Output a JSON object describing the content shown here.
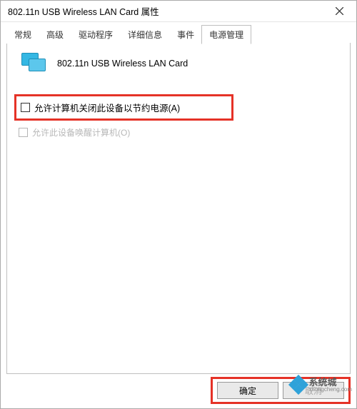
{
  "window": {
    "title": "802.11n USB Wireless LAN Card 属性"
  },
  "tabs": {
    "t0": "常规",
    "t1": "高级",
    "t2": "驱动程序",
    "t3": "详细信息",
    "t4": "事件",
    "t5": "电源管理"
  },
  "device": {
    "name": "802.11n USB Wireless LAN Card"
  },
  "options": {
    "allow_off_label": "允许计算机关闭此设备以节约电源(A)",
    "allow_off_checked": false,
    "allow_wake_label": "允许此设备唤醒计算机(O)",
    "allow_wake_enabled": false
  },
  "buttons": {
    "ok": "确定",
    "cancel": "取消"
  },
  "watermark": {
    "text": "系统城",
    "url": "xitongcheng.com"
  }
}
